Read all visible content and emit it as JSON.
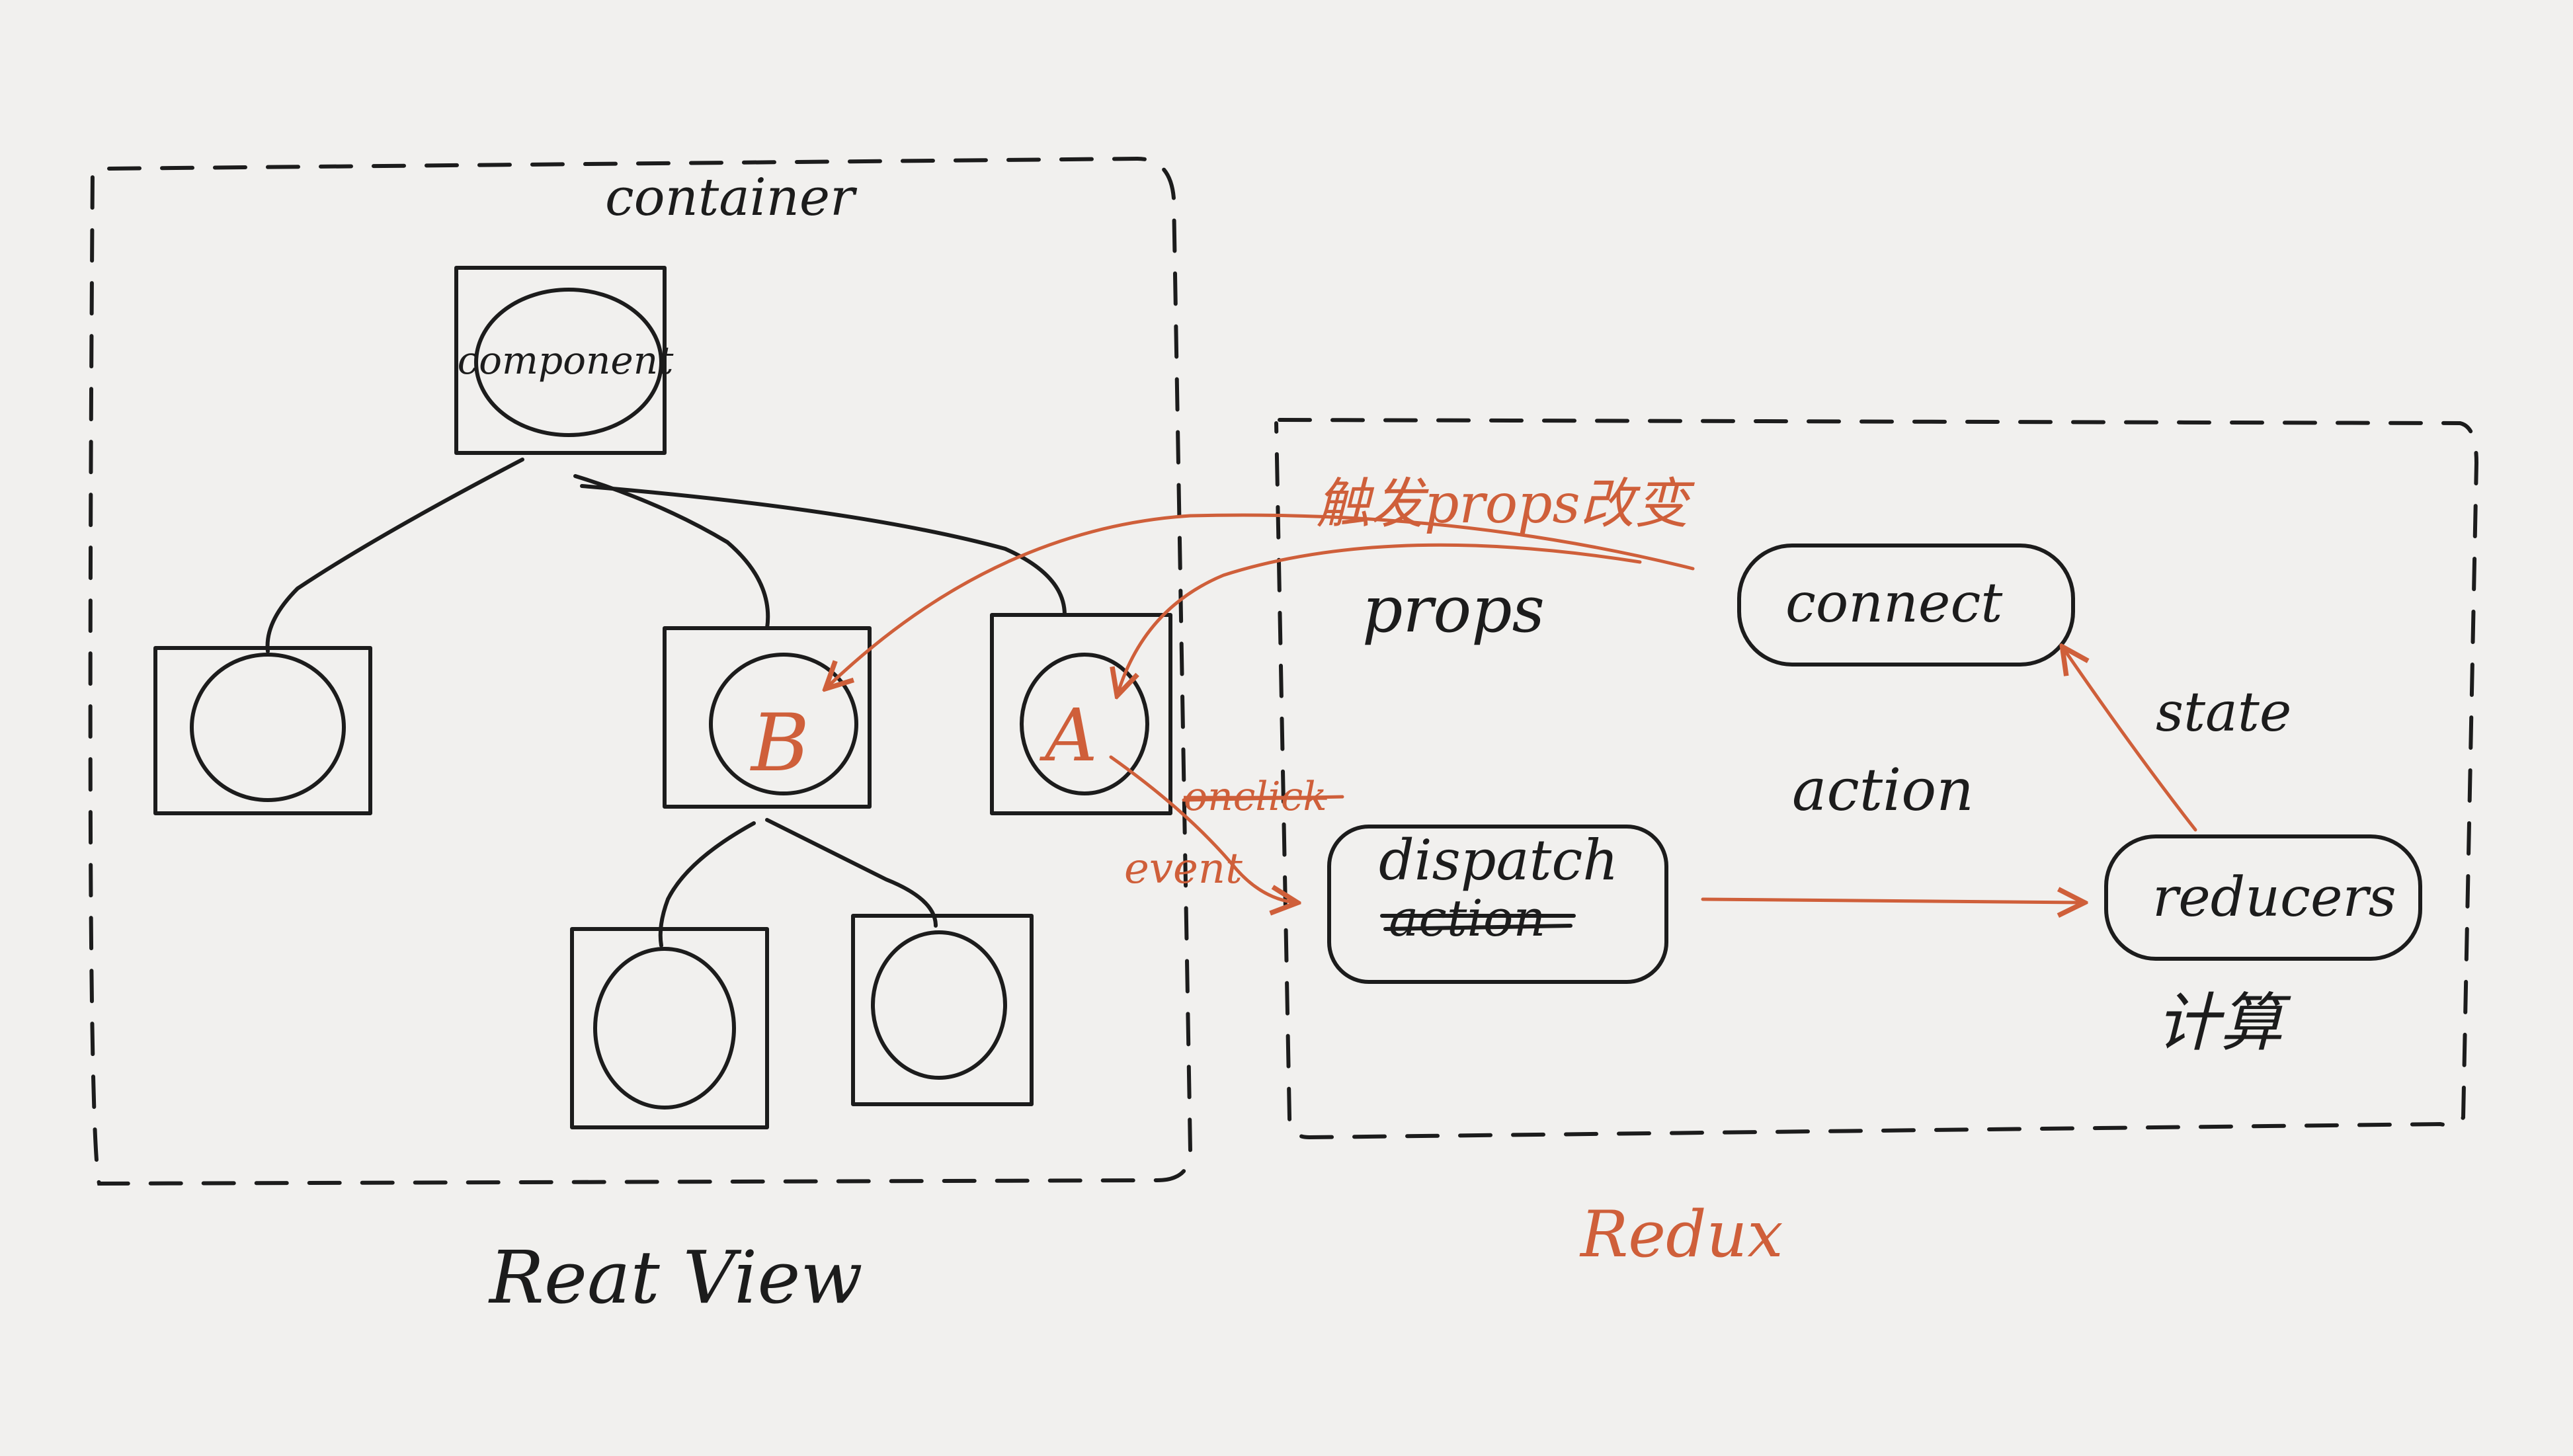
{
  "colors": {
    "paper": "#f1f0ee",
    "ink": "#1c1c1c",
    "accent": "#cf5f3a"
  },
  "labels": {
    "container": "container",
    "component": "component",
    "node_b": "B",
    "node_a": "A",
    "props_notice": "触发props改变",
    "props": "props",
    "connect": "connect",
    "state": "state",
    "action": "action",
    "onclick": "onclick",
    "event": "event",
    "dispatch": "dispatch",
    "dispatch_struck": "action",
    "reducers": "reducers",
    "compute": "计算",
    "react_view": "Reat View",
    "redux": "Redux"
  }
}
